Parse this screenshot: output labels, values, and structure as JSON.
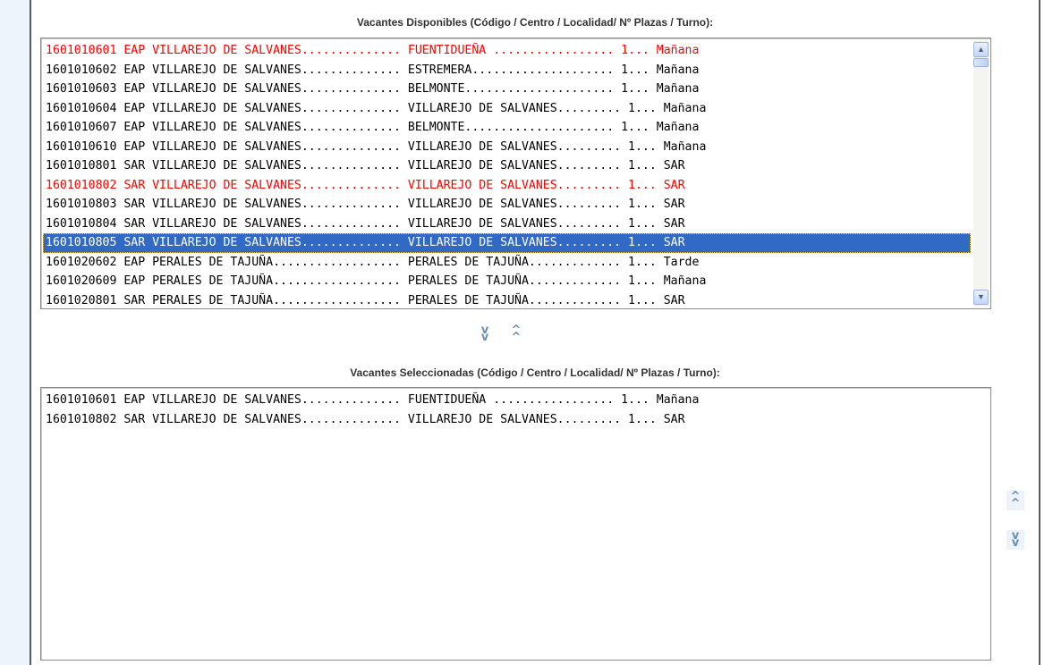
{
  "colors": {
    "highlight_text": "#ff0000",
    "selected_row_bg": "#316ac5",
    "selected_row_text": "#ffffff",
    "panel_border": "#5a5a5a",
    "side_strip": "#eef4fb"
  },
  "available": {
    "heading": "Vacantes Disponibles (Código / Centro / Localidad/ Nº Plazas / Turno):",
    "rows": [
      {
        "text": "1601010601 EAP VILLAREJO DE SALVANES.............. FUENTIDUEÑA ................. 1... Mañana",
        "state": "highlight"
      },
      {
        "text": "1601010602 EAP VILLAREJO DE SALVANES.............. ESTREMERA.................... 1... Mañana",
        "state": "normal"
      },
      {
        "text": "1601010603 EAP VILLAREJO DE SALVANES.............. BELMONTE..................... 1... Mañana",
        "state": "normal"
      },
      {
        "text": "1601010604 EAP VILLAREJO DE SALVANES.............. VILLAREJO DE SALVANES......... 1... Mañana",
        "state": "normal"
      },
      {
        "text": "1601010607 EAP VILLAREJO DE SALVANES.............. BELMONTE..................... 1... Mañana",
        "state": "normal"
      },
      {
        "text": "1601010610 EAP VILLAREJO DE SALVANES.............. VILLAREJO DE SALVANES......... 1... Mañana",
        "state": "normal"
      },
      {
        "text": "1601010801 SAR VILLAREJO DE SALVANES.............. VILLAREJO DE SALVANES......... 1... SAR",
        "state": "normal"
      },
      {
        "text": "1601010802 SAR VILLAREJO DE SALVANES.............. VILLAREJO DE SALVANES......... 1... SAR",
        "state": "highlight"
      },
      {
        "text": "1601010803 SAR VILLAREJO DE SALVANES.............. VILLAREJO DE SALVANES......... 1... SAR",
        "state": "normal"
      },
      {
        "text": "1601010804 SAR VILLAREJO DE SALVANES.............. VILLAREJO DE SALVANES......... 1... SAR",
        "state": "normal"
      },
      {
        "text": "1601010805 SAR VILLAREJO DE SALVANES.............. VILLAREJO DE SALVANES......... 1... SAR",
        "state": "selected"
      },
      {
        "text": "1601020602 EAP PERALES DE TAJUÑA.................. PERALES DE TAJUÑA............. 1... Tarde",
        "state": "normal"
      },
      {
        "text": "1601020609 EAP PERALES DE TAJUÑA.................. PERALES DE TAJUÑA............. 1... Mañana",
        "state": "normal"
      },
      {
        "text": "1601020801 SAR PERALES DE TAJUÑA.................. PERALES DE TAJUÑA............. 1... SAR",
        "state": "normal"
      }
    ],
    "scroll_up_icon": "▲",
    "scroll_down_icon": "▼"
  },
  "transfer": {
    "add_icon": "double-chevron-down",
    "remove_icon": "double-chevron-up"
  },
  "selected": {
    "heading": "Vacantes Seleccionadas (Código / Centro / Localidad/ Nº Plazas / Turno):",
    "rows": [
      {
        "text": "1601010601 EAP VILLAREJO DE SALVANES.............. FUENTIDUEÑA ................. 1... Mañana",
        "state": "normal"
      },
      {
        "text": "1601010802 SAR VILLAREJO DE SALVANES.............. VILLAREJO DE SALVANES......... 1... SAR",
        "state": "normal"
      }
    ]
  },
  "order": {
    "move_up_icon": "double-chevron-up",
    "move_down_icon": "double-chevron-down"
  }
}
